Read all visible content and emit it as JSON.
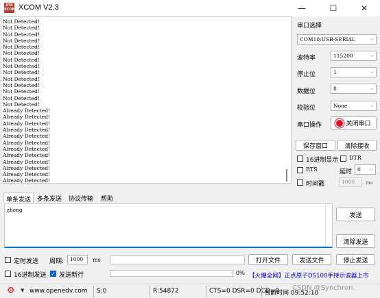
{
  "app": {
    "icon_text": "ATK\nXCOM",
    "title": "XCOM V2.3"
  },
  "window_controls": {
    "minimize": "—",
    "maximize": "☐",
    "close": "✕"
  },
  "receive": {
    "lines": [
      "Not Detected!",
      "Not Detected!",
      "Not Detected!",
      "Not Detected!",
      "Not Detected!",
      "Not Detected!",
      "Not Detected!",
      "Not Detected!",
      "Not Detected!",
      "Not Detected!",
      "Not Detected!",
      "Not Detected!",
      "Not Detected!",
      "Not Detected!",
      "Already Detected!",
      "Already Detected!",
      "Already Detected!",
      "Already Detected!",
      "Already Detected!",
      "Already Detected!",
      "Already Detected!",
      "Already Detected!",
      "Already Detected!",
      "Already Detected!",
      "Already Detected!",
      "Already Detected!"
    ]
  },
  "serial": {
    "port_select_label": "串口选择",
    "port_value": "COM10:USB-SERIAL",
    "baud_label": "波特率",
    "baud_value": "115200",
    "stopbits_label": "停止位",
    "stopbits_value": "1",
    "databits_label": "数据位",
    "databits_value": "8",
    "parity_label": "校验位",
    "parity_value": "None",
    "operation_label": "串口操作",
    "close_port_label": "关闭串口",
    "save_window_label": "保存窗口",
    "clear_receive_label": "清除接收",
    "hex_display_label": "16进制显示",
    "dtr_label": "DTR",
    "rts_label": "RTS",
    "delay_label": "延时",
    "delay_value": "0",
    "timestamp_label": "时间戳",
    "timestamp_value": "1000",
    "timestamp_unit": "ms",
    "dropdown_arrow": "⌵"
  },
  "tabs": [
    {
      "label": "单条发送",
      "active": true
    },
    {
      "label": "多条发送",
      "active": false
    },
    {
      "label": "协议传输",
      "active": false
    },
    {
      "label": "帮助",
      "active": false
    }
  ],
  "send": {
    "text": "zheng",
    "send_label": "发送",
    "clear_send_label": "清除发送",
    "timed_send_label": "定时发送",
    "period_label": "周期:",
    "period_value": "1000",
    "period_unit": "ms",
    "hex_send_label": "16进制发送",
    "send_newline_label": "发送新行",
    "progress_text": "0%",
    "open_file_label": "打开文件",
    "send_file_label": "发送文件",
    "stop_send_label": "停止发送",
    "promo_link": "【火爆全网】正点原子DS100手持示波器上市"
  },
  "status": {
    "website": "www.openedv.com",
    "sent": "S:0",
    "received": "R:54872",
    "lines": "CTS=0 DSR=0 DCD=0",
    "time": "当前时间 09:52:10",
    "watermark": "CSDN @Synchron."
  },
  "colors": {
    "accent": "#0078d7",
    "promo": "#0000cc",
    "red": "#e81123"
  }
}
